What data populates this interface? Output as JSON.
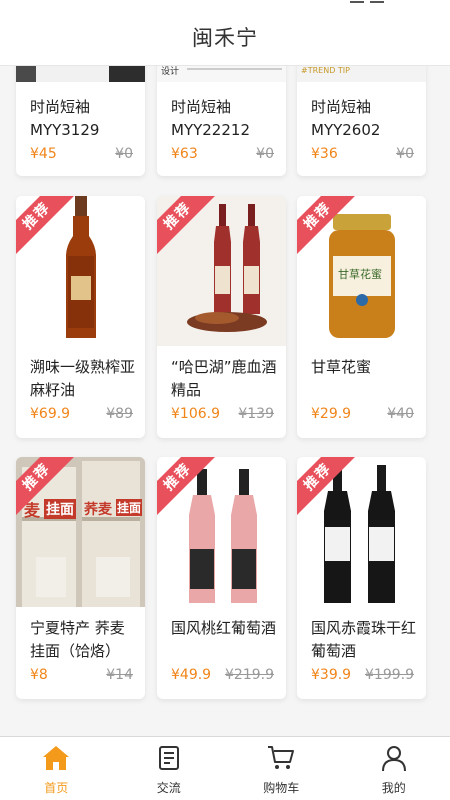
{
  "header": {
    "title": "闽禾宁"
  },
  "products": [
    {
      "ribbon": "",
      "name": "时尚短袖MYY3129",
      "price": "¥45",
      "original_price": "¥0"
    },
    {
      "ribbon": "",
      "name": "时尚短袖MYY22212",
      "price": "¥63",
      "original_price": "¥0"
    },
    {
      "ribbon": "",
      "name": "时尚短袖MYY2602",
      "price": "¥36",
      "original_price": "¥0"
    },
    {
      "ribbon": "推荐",
      "name": "溯味一级熟榨亚麻籽油",
      "price": "¥69.9",
      "original_price": "¥89"
    },
    {
      "ribbon": "推荐",
      "name": "“哈巴湖”鹿血酒精品",
      "price": "¥106.9",
      "original_price": "¥139"
    },
    {
      "ribbon": "推荐",
      "name": "甘草花蜜",
      "price": "¥29.9",
      "original_price": "¥40"
    },
    {
      "ribbon": "推荐",
      "name": "宁夏特产 荞麦挂面（饸烙）",
      "price": "¥8",
      "original_price": "¥14"
    },
    {
      "ribbon": "推荐",
      "name": "国风桃红葡萄酒",
      "price": "¥49.9",
      "original_price": "¥219.9"
    },
    {
      "ribbon": "推荐",
      "name": "国风赤霞珠干红葡萄酒",
      "price": "¥39.9",
      "original_price": "¥199.9"
    }
  ],
  "image_text": {
    "banner_text": "设计",
    "trend_tip": "#TREND TIP",
    "honey_label": "甘草花蜜",
    "noodle_brand_1": "麦",
    "noodle_brand_2": "荞麦",
    "noodle_word": "挂面"
  },
  "tabbar": {
    "items": [
      {
        "label": "首页",
        "icon": "home-icon",
        "active": true
      },
      {
        "label": "交流",
        "icon": "document-icon",
        "active": false
      },
      {
        "label": "购物车",
        "icon": "cart-icon",
        "active": false
      },
      {
        "label": "我的",
        "icon": "user-icon",
        "active": false
      }
    ]
  },
  "colors": {
    "accent": "#f39a1a",
    "price": "#f08519",
    "ribbon": "#e8505b"
  }
}
